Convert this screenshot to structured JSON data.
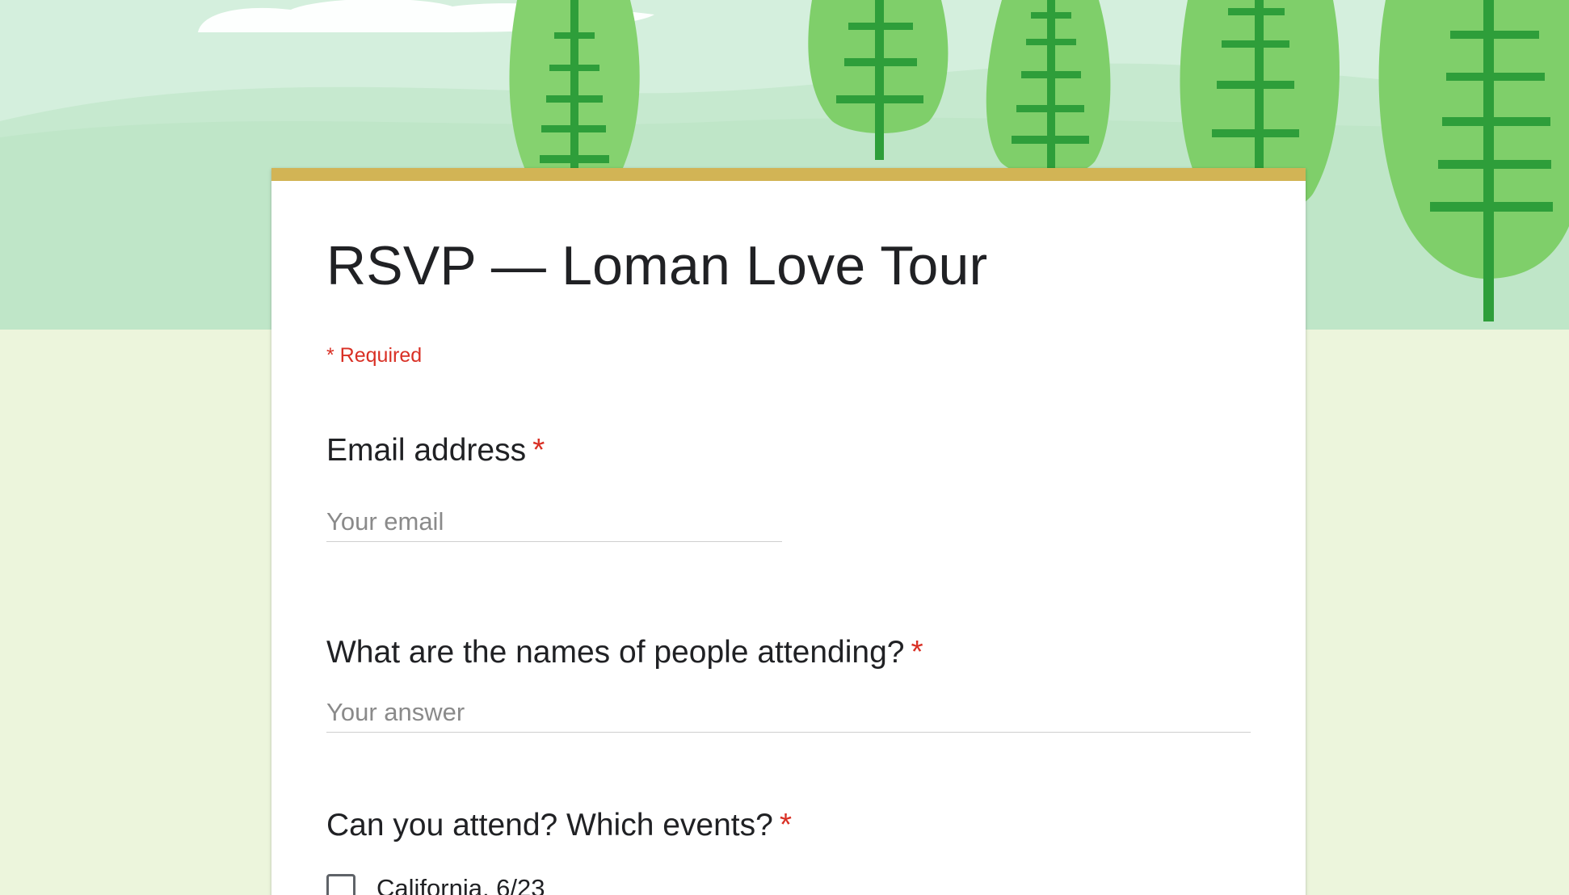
{
  "header": {
    "theme_colors": {
      "sky": "#d4efdd",
      "hill_light": "#c6e9cf",
      "hill_dark": "#b5e1c1",
      "tree_light": "#7fcf6a",
      "tree_mid": "#6cc45b",
      "tree_trunk": "#2e9e3a",
      "cloud": "#ffffff"
    }
  },
  "form": {
    "accent_color": "#d2b455",
    "title": "RSVP — Loman Love Tour",
    "required_note": "* Required",
    "questions": {
      "email": {
        "label": "Email address",
        "required_mark": "*",
        "placeholder": "Your email",
        "value": ""
      },
      "names": {
        "label": "What are the names of people attending?",
        "required_mark": "*",
        "placeholder": "Your answer",
        "value": ""
      },
      "events": {
        "label": "Can you attend? Which events?",
        "required_mark": "*",
        "options": [
          {
            "label": "California, 6/23",
            "checked": false
          }
        ]
      }
    }
  }
}
